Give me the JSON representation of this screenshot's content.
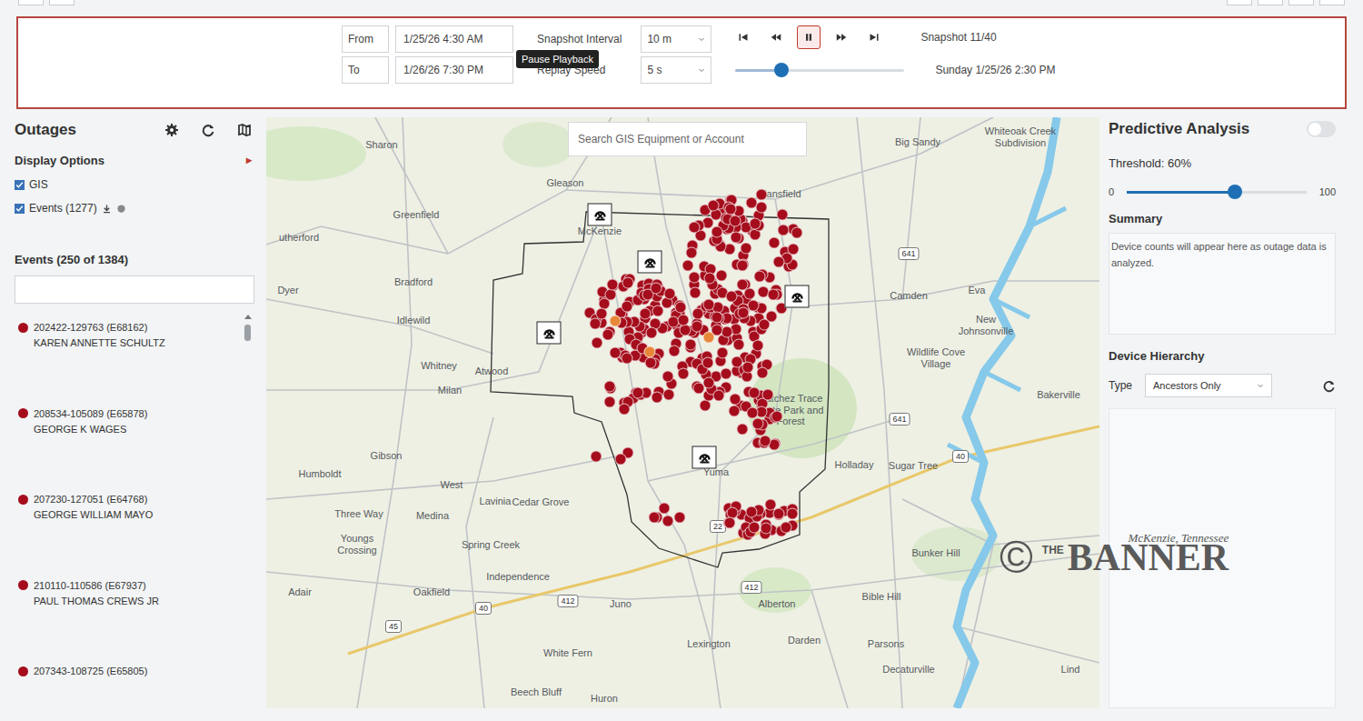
{
  "controls": {
    "from_label": "From",
    "from_value": "1/25/26 4:30 AM",
    "to_label": "To",
    "to_value": "1/26/26 7:30 PM",
    "interval_label": "Snapshot Interval",
    "interval_value": "10 m",
    "speed_label": "Replay Speed",
    "speed_value": "5 s",
    "playback_buttons": [
      {
        "kind": "first",
        "selected": false
      },
      {
        "kind": "back",
        "selected": false
      },
      {
        "kind": "pause",
        "selected": true
      },
      {
        "kind": "forward",
        "selected": false
      },
      {
        "kind": "last",
        "selected": false
      }
    ],
    "tooltip": "Pause Playback",
    "snapshot": "Snapshot 11/40",
    "timestamp": "Sunday 1/25/26 2:30 PM",
    "timeline_level": 0.27
  },
  "outages": {
    "title": "Outages",
    "display_options": "Display Options",
    "expand_glyph": "▸",
    "layers": [
      {
        "label": "GIS",
        "checked": true
      },
      {
        "label": "Events (1277)",
        "checked": true
      }
    ],
    "events_title": "Events (250 of 1384)",
    "events": [
      {
        "id": "202422-129763 (E68162)",
        "name": "KAREN ANNETTE SCHULTZ",
        "color": "#a50d1c"
      },
      {
        "id": "208534-105089 (E65878)",
        "name": "GEORGE K WAGES",
        "color": "#a50d1c"
      },
      {
        "id": "207230-127051 (E64768)",
        "name": "GEORGE WILLIAM MAYO",
        "color": "#a50d1c"
      },
      {
        "id": "210110-110586 (E67937)",
        "name": "PAUL THOMAS CREWS JR",
        "color": "#a50d1c"
      },
      {
        "id": "207343-108725 (E65805)",
        "color": "#a50d1c"
      }
    ]
  },
  "map": {
    "search_placeholder": "Search GIS Equipment or Account",
    "labels": [
      "Sharon",
      "Gleason",
      "Big Sandy",
      "Whiteoak Creek Subdivision",
      "Greenfield",
      "utherford",
      "Mansfield",
      "McKenzie",
      "Bradford",
      "Dyer",
      "Camden",
      "Eva",
      "Idlewild",
      "New Johnsonville",
      "Wildlife Cove Village",
      "Whitney",
      "Atwood",
      "Milan",
      "Bakerville",
      "Natchez Trace State Park and Forest",
      "Gibson",
      "Holladay",
      "Sugar Tree",
      "Humboldt",
      "Yuma",
      "West",
      "Lavinia",
      "Cedar Grove",
      "Three Way",
      "Medina",
      "Spring Creek",
      "Youngs Crossing",
      "Bunker Hill",
      "Independence",
      "Adair",
      "Oakfield",
      "Juno",
      "Alberton",
      "Bible Hill",
      "Darden",
      "Lexington",
      "Parsons",
      "White Fern",
      "Decaturville",
      "Lind",
      "Beech Bluff",
      "Huron"
    ],
    "shields": [
      "641",
      "641",
      "40",
      "40",
      "412",
      "412",
      "22",
      "45"
    ],
    "markers": [
      {
        "color": "#a50d1c",
        "count": 105
      },
      {
        "color": "#a50d1c",
        "count": 60
      },
      {
        "color": "#a50d1c",
        "count": 55
      },
      {
        "color": "#a50d1c",
        "count": 22
      },
      {
        "color": "#a50d1c",
        "count": 14
      },
      {
        "color": "#a50d1c",
        "count": 32
      },
      {
        "color": "#a50d1c",
        "count": 5
      },
      {
        "color": "#a50d1c",
        "count": 3
      },
      {
        "color": "#a50d1c",
        "count": 45
      },
      {
        "color": "#e8873a",
        "count": 3
      }
    ]
  },
  "predictive": {
    "title": "Predictive Analysis",
    "enabled": false,
    "threshold_label": "Threshold: 60%",
    "threshold_level": 0.6,
    "min": "0",
    "max": "100",
    "summary_title": "Summary",
    "summary_text": "Device counts will appear here as outage data is analyzed.",
    "hierarchy_title": "Device Hierarchy",
    "type_label": "Type",
    "type_value": "Ancestors Only"
  },
  "watermark": {
    "symbol": "©",
    "the": "THE",
    "name": "BANNER",
    "place": "McKenzie, Tennessee"
  }
}
